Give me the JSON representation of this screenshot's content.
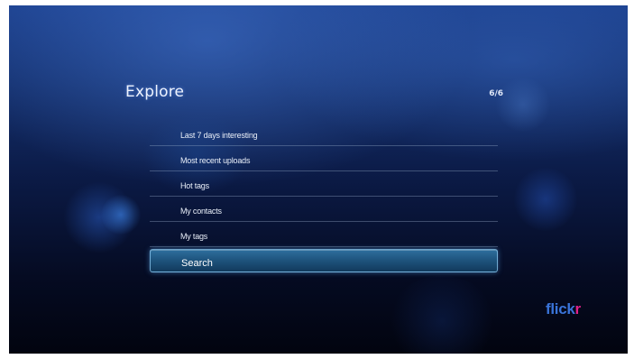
{
  "header": {
    "title": "Explore",
    "page_counter": "6/6"
  },
  "menu": {
    "items": [
      {
        "label": "Last 7 days interesting",
        "selected": false
      },
      {
        "label": "Most recent uploads",
        "selected": false
      },
      {
        "label": "Hot tags",
        "selected": false
      },
      {
        "label": "My contacts",
        "selected": false
      },
      {
        "label": "My tags",
        "selected": false
      },
      {
        "label": "Search",
        "selected": true
      }
    ]
  },
  "brand": {
    "name": "flickr",
    "logo_part1": "flick",
    "logo_part2": "r",
    "colors": {
      "blue": "#3a74d9",
      "pink": "#e0218a"
    }
  },
  "theme": {
    "background_top": "#1b3f8c",
    "background_bottom": "#02040f",
    "highlight": "#2e6f9e"
  }
}
